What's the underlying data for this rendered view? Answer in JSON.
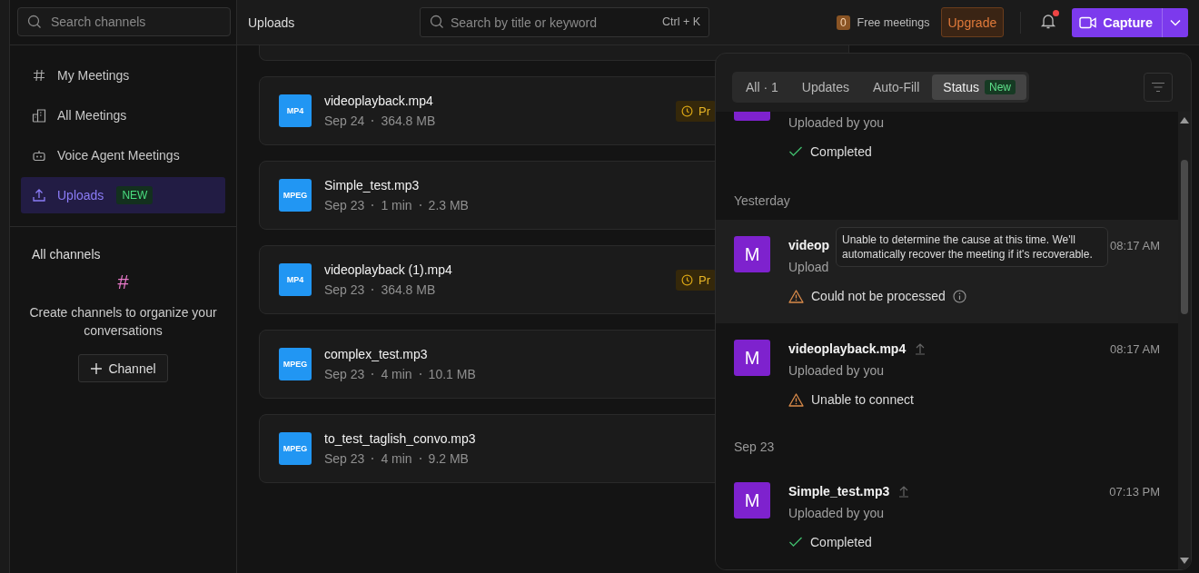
{
  "sidebar": {
    "search": {
      "placeholder": "Search channels"
    },
    "items": [
      {
        "label": "My Meetings",
        "selected": false
      },
      {
        "label": "All Meetings",
        "selected": false
      },
      {
        "label": "Voice Agent Meetings",
        "selected": false
      },
      {
        "label": "Uploads",
        "selected": true,
        "badge": "NEW"
      }
    ],
    "channels": {
      "title": "All channels",
      "icon": "#",
      "message": "Create channels to organize your conversations",
      "button": "Channel"
    }
  },
  "header": {
    "title": "Uploads",
    "search": {
      "placeholder": "Search by title or keyword",
      "shortcut": "Ctrl + K"
    },
    "free_count": "0",
    "free_label": "Free meetings",
    "upgrade": "Upgrade",
    "notification_unread": true,
    "capture": "Capture"
  },
  "files": [
    {
      "cut": true
    },
    {
      "type": "MP4",
      "name": "videoplayback.mp4",
      "meta": [
        "Sep 24",
        "364.8 MB"
      ],
      "chip": "Pr"
    },
    {
      "type": "MPEG",
      "name": "Simple_test.mp3",
      "meta": [
        "Sep 23",
        "1 min",
        "2.3 MB"
      ]
    },
    {
      "type": "MP4",
      "name": "videoplayback (1).mp4",
      "meta": [
        "Sep 23",
        "364.8 MB"
      ],
      "chip": "Pr"
    },
    {
      "type": "MPEG",
      "name": "complex_test.mp3",
      "meta": [
        "Sep 23",
        "4 min",
        "10.1 MB"
      ]
    },
    {
      "type": "MPEG",
      "name": "to_test_taglish_convo.mp3",
      "meta": [
        "Sep 23",
        "4 min",
        "9.2 MB"
      ]
    }
  ],
  "panel": {
    "tabs": [
      {
        "label": "All · 1",
        "selected": false
      },
      {
        "label": "Updates",
        "selected": false
      },
      {
        "label": "Auto-Fill",
        "selected": false
      },
      {
        "label": "Status",
        "selected": true,
        "badge": "New"
      }
    ],
    "entries": [
      {
        "kind": "completed",
        "cut": true,
        "subtitle": "Uploaded by you",
        "status": "Completed"
      },
      {
        "kind": "label",
        "text": "Yesterday"
      },
      {
        "kind": "failed",
        "initial": "M",
        "name": "videop",
        "subtitle": "Upload",
        "time": "08:17 AM",
        "status": "Could not be processed",
        "info": true,
        "highlighted": true,
        "tooltip": "Unable to determine the cause at this time. We'll automatically recover the meeting if it's recoverable."
      },
      {
        "kind": "failed",
        "initial": "M",
        "name": "videoplayback.mp4",
        "upload_icon": true,
        "subtitle": "Uploaded by you",
        "time": "08:17 AM",
        "status": "Unable to connect"
      },
      {
        "kind": "label",
        "text": "Sep 23"
      },
      {
        "kind": "completed",
        "initial": "M",
        "name": "Simple_test.mp3",
        "upload_icon": true,
        "subtitle": "Uploaded by you",
        "time": "07:13 PM",
        "status": "Completed"
      }
    ]
  }
}
